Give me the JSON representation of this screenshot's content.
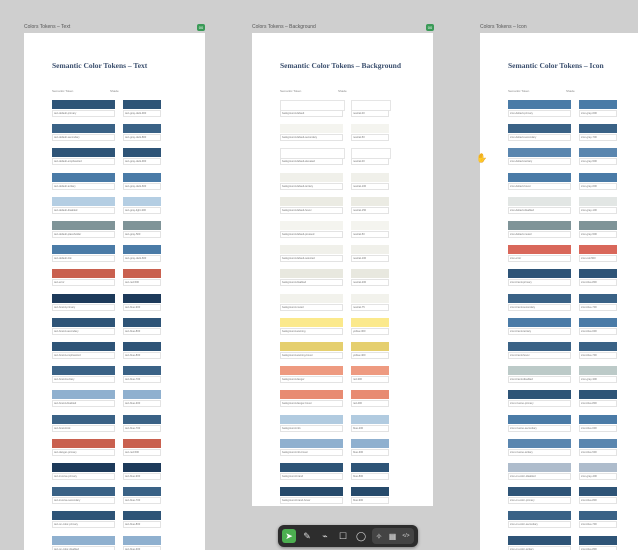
{
  "frames": [
    {
      "label": "Colors Tokens – Text",
      "badge": "00",
      "title": "Semantic Color Tokens – Text",
      "header": [
        "Semantic Token",
        "Shade"
      ],
      "rows": [
        {
          "color": "#2e5477",
          "token": "text-default-primary",
          "shade": "text-gray-dark-900"
        },
        {
          "color": "#3a6286",
          "token": "text-default-secondary",
          "shade": "text-gray-dark-800"
        },
        {
          "color": "#2e5477",
          "token": "text-default-emphasized",
          "shade": "text-gray-dark-900"
        },
        {
          "color": "#4a7ba7",
          "token": "text-default-tertiary",
          "shade": "text-gray-dark-600"
        },
        {
          "color": "#b4cee3",
          "token": "text-default-disabled",
          "shade": "text-gray-light-300"
        },
        {
          "color": "#7f9498",
          "token": "text-default-placeholder",
          "shade": "text-gray-500"
        },
        {
          "color": "#4a7ba7",
          "token": "text-default-link",
          "shade": "text-gray-dark-600"
        },
        {
          "color": "#c9604f",
          "token": "text-error",
          "shade": "text-red-500"
        },
        {
          "color": "#1d3a5a",
          "token": "text-brand-primary",
          "shade": "text-blue-900"
        },
        {
          "color": "#2e5477",
          "token": "text-brand-secondary",
          "shade": "text-blue-800"
        },
        {
          "color": "#2e5477",
          "token": "text-brand-emphasized",
          "shade": "text-blue-800"
        },
        {
          "color": "#3a6286",
          "token": "text-brand-tertiary",
          "shade": "text-blue-700"
        },
        {
          "color": "#8fb0cf",
          "token": "text-brand-disabled",
          "shade": "text-blue-300"
        },
        {
          "color": "#3a6286",
          "token": "text-brand-link",
          "shade": "text-blue-700"
        },
        {
          "color": "#c9604f",
          "token": "text-danger-primary",
          "shade": "text-red-500"
        },
        {
          "color": "#1d3a5a",
          "token": "text-inverse-primary",
          "shade": "text-blue-900"
        },
        {
          "color": "#3a6286",
          "token": "text-inverse-secondary",
          "shade": "text-blue-700"
        },
        {
          "color": "#2e5477",
          "token": "text-on-color-primary",
          "shade": "text-blue-800"
        },
        {
          "color": "#8fb0cf",
          "token": "text-on-color-disabled",
          "shade": "text-blue-300"
        }
      ]
    },
    {
      "label": "Colors Tokens – Background",
      "badge": "00",
      "title": "Semantic Color Tokens – Background",
      "header": [
        "Semantic Token",
        "Shade"
      ],
      "rows": [
        {
          "color": "#ffffff",
          "token": "background-default",
          "shade": "neutral-00"
        },
        {
          "color": "#f4f4ef",
          "token": "background-default-secondary",
          "shade": "neutral-50"
        },
        {
          "color": "#ffffff",
          "token": "background-default-elevated",
          "shade": "neutral-00"
        },
        {
          "color": "#f0f0ea",
          "token": "background-default-tertiary",
          "shade": "neutral-100"
        },
        {
          "color": "#ebebe3",
          "token": "background-default-hover",
          "shade": "neutral-150"
        },
        {
          "color": "#f4f4ef",
          "token": "background-default-pressed",
          "shade": "neutral-50"
        },
        {
          "color": "#f0f0ea",
          "token": "background-default-selected",
          "shade": "neutral-100"
        },
        {
          "color": "#e8e8df",
          "token": "background-disabled",
          "shade": "neutral-200"
        },
        {
          "color": "#f2f2ec",
          "token": "background-muted",
          "shade": "neutral-75"
        },
        {
          "color": "#fbe98c",
          "token": "background-warning",
          "shade": "yellow-300"
        },
        {
          "color": "#e5cf6e",
          "token": "background-warning-hover",
          "shade": "yellow-400"
        },
        {
          "color": "#ee9a80",
          "token": "background-danger",
          "shade": "red-300"
        },
        {
          "color": "#e88b72",
          "token": "background-danger-hover",
          "shade": "red-400"
        },
        {
          "color": "#b1cbe0",
          "token": "background-info",
          "shade": "blue-200"
        },
        {
          "color": "#8fb0cf",
          "token": "background-info-hover",
          "shade": "blue-300"
        },
        {
          "color": "#2e5477",
          "token": "background-brand",
          "shade": "blue-800"
        },
        {
          "color": "#264a6b",
          "token": "background-brand-hover",
          "shade": "blue-900"
        }
      ]
    },
    {
      "label": "Colors Tokens – Icon",
      "badge": "00",
      "title": "Semantic Color Tokens – Icon",
      "header": [
        "Semantic Token",
        "Shade"
      ],
      "rows": [
        {
          "color": "#4a7ba7",
          "token": "icon-default-primary",
          "shade": "icon-gray-600"
        },
        {
          "color": "#3a6286",
          "token": "icon-default-secondary",
          "shade": "icon-gray-700"
        },
        {
          "color": "#5a86af",
          "token": "icon-default-tertiary",
          "shade": "icon-gray-500"
        },
        {
          "color": "#4a7ba7",
          "token": "icon-default-hover",
          "shade": "icon-gray-600"
        },
        {
          "color": "#e2e6e4",
          "token": "icon-default-disabled",
          "shade": "icon-gray-100"
        },
        {
          "color": "#7f9498",
          "token": "icon-default-muted",
          "shade": "icon-gray-500"
        },
        {
          "color": "#d9675a",
          "token": "icon-error",
          "shade": "icon-red-500"
        },
        {
          "color": "#2e5477",
          "token": "icon-brand-primary",
          "shade": "icon-blue-800"
        },
        {
          "color": "#3a6286",
          "token": "icon-brand-secondary",
          "shade": "icon-blue-700"
        },
        {
          "color": "#4a7ba7",
          "token": "icon-brand-tertiary",
          "shade": "icon-blue-600"
        },
        {
          "color": "#3a6286",
          "token": "icon-brand-hover",
          "shade": "icon-blue-700"
        },
        {
          "color": "#bccac8",
          "token": "icon-brand-disabled",
          "shade": "icon-gray-300"
        },
        {
          "color": "#2e5477",
          "token": "icon-inverse-primary",
          "shade": "icon-blue-800"
        },
        {
          "color": "#4a7ba7",
          "token": "icon-inverse-secondary",
          "shade": "icon-blue-600"
        },
        {
          "color": "#5a86af",
          "token": "icon-inverse-tertiary",
          "shade": "icon-blue-500"
        },
        {
          "color": "#aebccc",
          "token": "icon-on-color-disabled",
          "shade": "icon-gray-400"
        },
        {
          "color": "#2e5477",
          "token": "icon-on-color-primary",
          "shade": "icon-blue-800"
        },
        {
          "color": "#3a6286",
          "token": "icon-on-color-secondary",
          "shade": "icon-blue-700"
        },
        {
          "color": "#2e5477",
          "token": "icon-on-color-tertiary",
          "shade": "icon-blue-800"
        }
      ]
    }
  ],
  "toolbar": {
    "tools": [
      {
        "icon": "move-pointer-icon",
        "glyph": "➤",
        "active": true
      },
      {
        "icon": "pen-icon",
        "glyph": "✎",
        "active": false
      },
      {
        "icon": "ruler-icon",
        "glyph": "⌁",
        "active": false
      },
      {
        "icon": "comment-icon",
        "glyph": "☐",
        "active": false
      },
      {
        "icon": "chat-bubble-icon",
        "glyph": "◯",
        "active": false
      }
    ],
    "group": [
      {
        "icon": "magic-icon",
        "glyph": "✧"
      },
      {
        "icon": "layout-icon",
        "glyph": "▦"
      },
      {
        "icon": "code-icon",
        "glyph": "</>"
      }
    ]
  },
  "cursor_icon": "hand-cursor-icon"
}
